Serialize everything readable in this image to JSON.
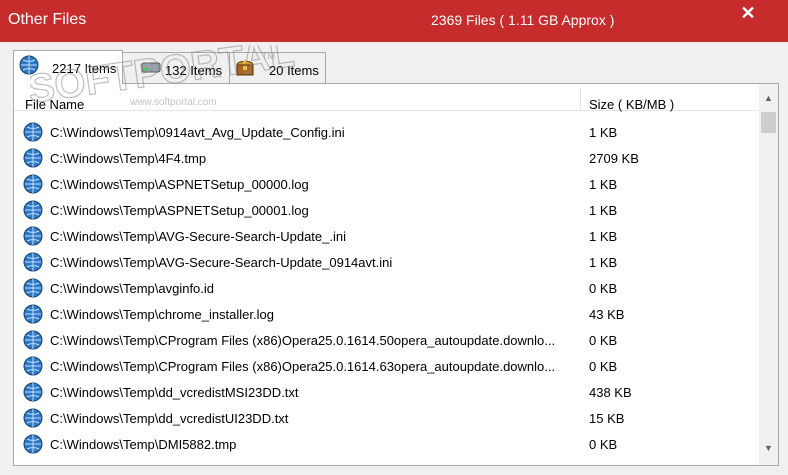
{
  "window": {
    "title": "Other Files",
    "summary": "2369 Files ( 1.11 GB Approx )",
    "close_label": "✕",
    "accent_color": "#c62c2c"
  },
  "tabs": [
    {
      "label": "2217 Items",
      "icon": "globe-icon",
      "active": true
    },
    {
      "label": "132 Items",
      "icon": "drive-icon",
      "active": false
    },
    {
      "label": "20 Items",
      "icon": "treasure-chest-icon",
      "active": false
    }
  ],
  "table": {
    "columns": [
      "File Name",
      "Size ( KB/MB )"
    ],
    "rows": [
      {
        "name": "C:\\Windows\\Temp\\0914avt_Avg_Update_Config.ini",
        "size": "1 KB"
      },
      {
        "name": "C:\\Windows\\Temp\\4F4.tmp",
        "size": "2709 KB"
      },
      {
        "name": "C:\\Windows\\Temp\\ASPNETSetup_00000.log",
        "size": "1 KB"
      },
      {
        "name": "C:\\Windows\\Temp\\ASPNETSetup_00001.log",
        "size": "1 KB"
      },
      {
        "name": "C:\\Windows\\Temp\\AVG-Secure-Search-Update_.ini",
        "size": "1 KB"
      },
      {
        "name": "C:\\Windows\\Temp\\AVG-Secure-Search-Update_0914avt.ini",
        "size": "1 KB"
      },
      {
        "name": "C:\\Windows\\Temp\\avginfo.id",
        "size": "0 KB"
      },
      {
        "name": "C:\\Windows\\Temp\\chrome_installer.log",
        "size": "43 KB"
      },
      {
        "name": "C:\\Windows\\Temp\\CProgram Files (x86)Opera25.0.1614.50opera_autoupdate.downlo...",
        "size": "0 KB"
      },
      {
        "name": "C:\\Windows\\Temp\\CProgram Files (x86)Opera25.0.1614.63opera_autoupdate.downlo...",
        "size": "0 KB"
      },
      {
        "name": "C:\\Windows\\Temp\\dd_vcredistMSI23DD.txt",
        "size": "438 KB"
      },
      {
        "name": "C:\\Windows\\Temp\\dd_vcredistUI23DD.txt",
        "size": "15 KB"
      },
      {
        "name": "C:\\Windows\\Temp\\DMI5882.tmp",
        "size": "0 KB"
      }
    ]
  },
  "watermark": {
    "text": "SOFTPORTAL",
    "url": "www.softportal.com",
    "mark": "TM"
  }
}
